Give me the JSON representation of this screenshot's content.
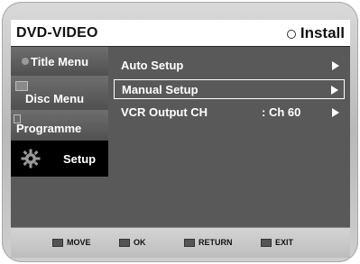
{
  "header": {
    "title": "DVD-VIDEO",
    "mode": "Install"
  },
  "nav": {
    "items": [
      {
        "label": "Title Menu",
        "icon": "disc-dot-icon"
      },
      {
        "label": "Disc Menu",
        "icon": "disc-menu-icon"
      },
      {
        "label": "Programme",
        "icon": "programme-icon"
      },
      {
        "label": "Setup",
        "icon": "gear-icon",
        "active": true
      }
    ]
  },
  "menu": {
    "items": [
      {
        "label": "Auto Setup",
        "value": ""
      },
      {
        "label": "Manual Setup",
        "value": "",
        "selected": true
      },
      {
        "label": "VCR Output CH",
        "value": ": Ch 60"
      }
    ]
  },
  "footer": {
    "move": "MOVE",
    "ok": "OK",
    "return": "RETURN",
    "exit": "EXIT"
  },
  "colors": {
    "panel": "#595959",
    "header_bg": "#ffffff",
    "active_nav": "#000000",
    "footer_bg": "#c8c8c8"
  }
}
